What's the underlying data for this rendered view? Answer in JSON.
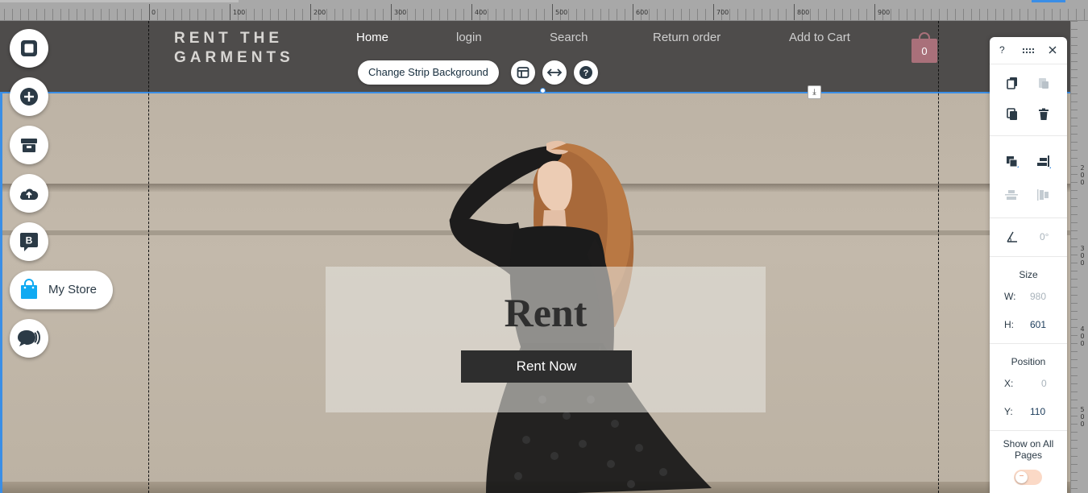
{
  "ruler": {
    "top_numbers": [
      "0",
      "100",
      "200",
      "300",
      "400",
      "500",
      "600",
      "700",
      "800",
      "900"
    ],
    "right_numbers": [
      "200",
      "300",
      "400",
      "500"
    ]
  },
  "header": {
    "logo_line1": "RENT THE",
    "logo_line2": "GARMENTS",
    "nav": [
      "Home",
      "login",
      "Search",
      "Return order",
      "Add to Cart"
    ],
    "cart_count": "0"
  },
  "strip_toolbar": {
    "change_background": "Change Strip Background"
  },
  "hero": {
    "title": "Rent",
    "button": "Rent Now"
  },
  "left_toolbar": {
    "my_store": "My Store",
    "badge_letter": "B"
  },
  "panel": {
    "help": "?",
    "rotation": "0°",
    "size_label": "Size",
    "w_label": "W:",
    "w_value": "980",
    "h_label": "H:",
    "h_value": "601",
    "position_label": "Position",
    "x_label": "X:",
    "x_value": "0",
    "y_label": "Y:",
    "y_value": "110",
    "show_all_pages": "Show on All Pages"
  },
  "colors": {
    "header_bg": "#4e4c4b",
    "selection_blue": "#3a8ee6",
    "cart": "#a9707a",
    "rent_button": "#2e2e2e"
  }
}
